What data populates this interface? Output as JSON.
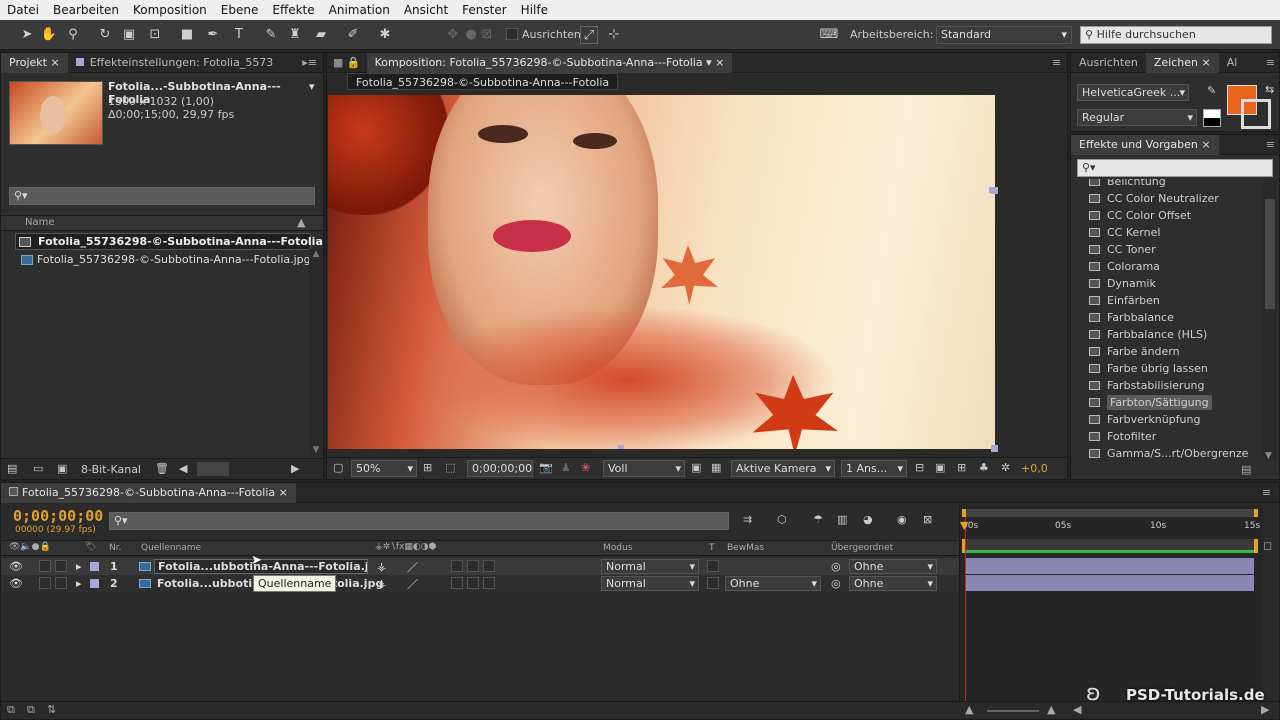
{
  "menu": [
    "Datei",
    "Bearbeiten",
    "Komposition",
    "Ebene",
    "Effekte",
    "Animation",
    "Ansicht",
    "Fenster",
    "Hilfe"
  ],
  "toolbar": {
    "ausrichten_label": "Ausrichten",
    "arbeitsbereich_label": "Arbeitsbereich:",
    "arbeitsbereich_value": "Standard",
    "help_placeholder": "Hilfe durchsuchen"
  },
  "project": {
    "tab_project": "Projekt",
    "tab_effects": "Effekteinstellungen: Fotolia_5573",
    "item_title": "Fotolia...-Subbotina-Anna---Fotolia",
    "item_dims": "1500 x 1032 (1,00)",
    "item_duration": "Δ0;00;15;00, 29,97 fps",
    "col_name": "Name",
    "items": [
      "Fotolia_55736298-©-Subbotina-Anna---Fotolia",
      "Fotolia_55736298-©-Subbotina-Anna---Fotolia.jpg"
    ],
    "bit_depth": "8-Bit-Kanal"
  },
  "composition": {
    "tab": "Komposition: Fotolia_55736298-©-Subbotina-Anna---Fotolia",
    "subtab": "Fotolia_55736298-©-Subbotina-Anna---Fotolia",
    "zoom": "50%",
    "timecode": "0;00;00;00",
    "resolution": "Voll",
    "camera": "Aktive Kamera",
    "view": "1 Ans...",
    "offset": "+0,0"
  },
  "right_panel": {
    "tabs": [
      "Ausrichten",
      "Zeichen",
      "Al"
    ],
    "font": "HelveticaGreek ...",
    "style": "Regular",
    "fill_color": "#e8641e",
    "effects_title": "Effekte und Vorgaben",
    "effects": [
      "Belichtung",
      "CC Color Neutralizer",
      "CC Color Offset",
      "CC Kernel",
      "CC Toner",
      "Colorama",
      "Dynamik",
      "Einfärben",
      "Farbbalance",
      "Farbbalance (HLS)",
      "Farbe ändern",
      "Farbe übrig lassen",
      "Farbstabilisierung",
      "Farbton/Sättigung",
      "Farbverknüpfung",
      "Fotofilter",
      "Gamma/S...rt/Obergrenze"
    ],
    "selected_effect": "Farbton/Sättigung"
  },
  "timeline": {
    "tab": "Fotolia_55736298-©-Subbotina-Anna---Fotolia",
    "timecode": "0;00;00;00",
    "fps": "00000 (29.97 fps)",
    "col_nr": "Nr.",
    "col_source": "Quellenname",
    "col_mode": "Modus",
    "col_t": "T",
    "col_bewmas": "BewMas",
    "col_parent": "Übergeordnet",
    "ruler": [
      "00s",
      "05s",
      "10s",
      "15s"
    ],
    "layers": [
      {
        "nr": "1",
        "name": "Fotolia...ubbotina-Anna---Fotolia.jpg",
        "mode": "Normal",
        "bewmas": "",
        "parent": "Ohne"
      },
      {
        "nr": "2",
        "name": "Fotolia...ubbotina-Anna---Fotolia.jpg",
        "mode": "Normal",
        "bewmas": "Ohne",
        "parent": "Ohne"
      }
    ],
    "tooltip": "Quellenname"
  },
  "watermark": "PSD-Tutorials.de",
  "colors": {
    "accent": "#e2a32a",
    "playhead": "#d62020",
    "layer_bar": "#8a87b5"
  }
}
